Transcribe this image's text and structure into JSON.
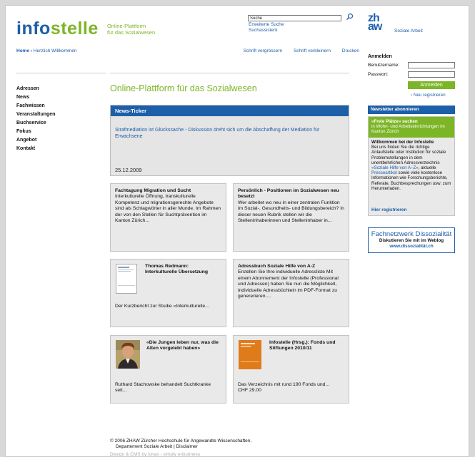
{
  "header": {
    "logo_part1": "info",
    "logo_part2": "stelle",
    "tagline_line1": "Online-Plattform",
    "tagline_line2": "für das Sozialwesen",
    "search_value": "Suche",
    "search_link1": "Erweiterte Suche",
    "search_link2": "Suchassistent",
    "zhaw_line1": "zh",
    "zhaw_line2": "aw",
    "zhaw_sub": "Soziale Arbeit"
  },
  "topbar": {
    "home": "Home",
    "separator": " › ",
    "current": "Herzlich Willkommen",
    "tool1": "Schrift vergrössern",
    "tool2": "Schrift verkleinern",
    "tool3": "Drucken"
  },
  "nav": [
    "Adressen",
    "News",
    "Fachwissen",
    "Veranstaltungen",
    "Buchservice",
    "Fokus",
    "Angebot",
    "Kontakt"
  ],
  "main": {
    "title": "Online-Plattform für das Sozialwesen",
    "ticker": {
      "head": "News-Ticker",
      "text": "Strafmediation ist Glückssache - Diskussion dreht sich um die Abschaffung der Mediation für Erwachsene",
      "date": "25.12.2009"
    },
    "cards": [
      {
        "title": "Fachtagung Migration und Sucht",
        "body": "Interkulturelle Öffnung, transkulturelle Kompetenz und migrationsgerechte Angebote sind als Schlagwörter in aller Munde. Im Rahmen der von den Stellen für Suchtprävention im Kanton Zürich..."
      },
      {
        "title": "Persönlich - Positionen im Sozialwesen neu besetzt",
        "body": "Wer arbeitet wo neu in einer zentralen Funktion im Sozial-, Gesundheits- und Bildungsbereich? In dieser neuen Rubrik stellen wir die Stelleninhaberinnen und Stelleninhaber in..."
      },
      {
        "title": "Thomas Redmann: Interkulturelle Übersetzung",
        "body": "Der Kurzbericht zur Studie «Interkulturelle..."
      },
      {
        "title": "Adressbuch Soziale Hilfe von A-Z",
        "body": "Erstellen Sie Ihre individuelle Adressliste Mit einem Abonnement der Infostelle (Professional und Adressen) haben Sie nun die Möglichkeit, individuelle Adressbüchlein im PDF-Format zu genererieren...."
      },
      {
        "title": "«Die Jungen leben nur, was die Alten vorgelebt haben»",
        "body": "Ruthard Stachowske behandelt Suchtkranke seit..."
      },
      {
        "title": "Infostelle (Hrsg.): Fonds und Stiftungen 2010/11",
        "body": "Das Verzeichnis mit rund 190 Fonds und...",
        "price": "CHF 29.00"
      }
    ]
  },
  "sidebar": {
    "login_title": "Anmelden",
    "username_label": "Benutzername:",
    "password_label": "Passwort:",
    "login_button": "Anmelden",
    "register_link": "› Neu registrieren",
    "newsletter": "Newsletter abonnieren",
    "promo_green_title": "«Freie Plätze» suchen",
    "promo_green_text": "in Wohn- und Arbeitseinrichtungen im Kanton Zürich",
    "promo_title": "Willkommen bei der Infostelle",
    "promo_text1": "Bei uns finden Sie die richtige Anlaufstelle oder Institution für soziale Problemstellungen in dem unentbehrlichen Adressverzeichnis",
    "promo_link1": "«Soziale Hilfe von A–Z»",
    "promo_text2": ", aktuelle",
    "promo_link2": "Presseartikel",
    "promo_text3": " sowie viele kostenlose Informationen wie Forschungsberichte, Referate, Buchbesprechungen usw. zum Herunterladen.",
    "promo_register": "Hier registrieren",
    "fnw_title": "Fachnetzwerk Dissozialität",
    "fnw_sub": "Diskutieren Sie mit im Weblog",
    "fnw_url": "www.dissozialität.ch"
  },
  "footer": {
    "line1": "© 2006 ZHAW Zürcher Hochschule für Angewandte Wissenschaften,",
    "line2_a": "Departement Soziale Arbeit",
    "line2_sep": " | ",
    "line2_b": "Disclaimer",
    "line3": "Design & CMS by ionas - simply e-business"
  },
  "colors": {
    "blue": "#1d5fa8",
    "green": "#7cb526",
    "orange": "#e07b1a"
  }
}
